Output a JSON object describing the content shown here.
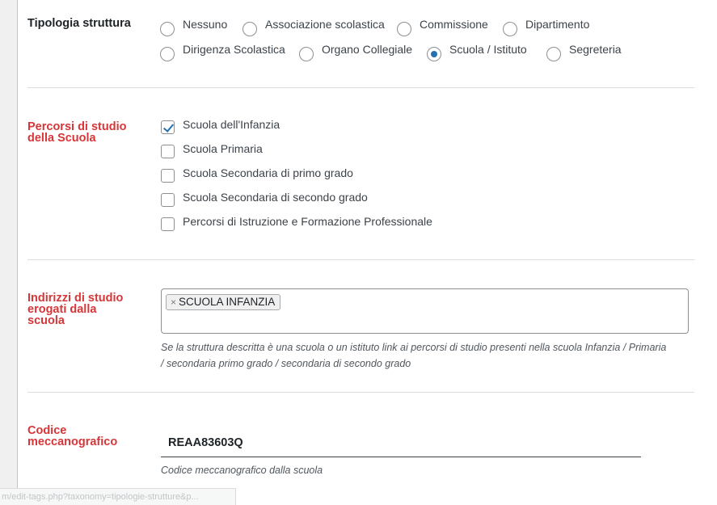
{
  "tipologia": {
    "label": "Tipologia struttura",
    "options": [
      "Nessuno",
      "Associazione scolastica",
      "Commissione",
      "Dipartimento",
      "Dirigenza Scolastica",
      "Organo Collegiale",
      "Scuola / Istituto",
      "Segreteria"
    ],
    "selected": "Scuola / Istituto"
  },
  "percorsi": {
    "label_line1": "Percorsi di studio",
    "label_line2": "della Scuola",
    "options": [
      "Scuola dell'Infanzia",
      "Scuola Primaria",
      "Scuola Secondaria di primo grado",
      "Scuola Secondaria di secondo grado",
      "Percorsi di Istruzione e Formazione Professionale"
    ],
    "checked": [
      "Scuola dell'Infanzia"
    ]
  },
  "indirizzi": {
    "label_line1": "Indirizzi di studio",
    "label_line2": "erogati dalla",
    "label_line3": "scuola",
    "tag_remove": "×",
    "tag": "SCUOLA INFANZIA",
    "description_line1": "Se la struttura descritta è una scuola o un istituto link ai percorsi di studio presenti nella scuola Infanzia / Primaria",
    "description_line2": "/ secondaria primo grado / secondaria di secondo grado"
  },
  "codice": {
    "label_line1": "Codice",
    "label_line2": "meccanografico",
    "value": "REAA83603Q",
    "description": "Codice meccanografico dalla scuola"
  },
  "status_bar": {
    "url": "m/edit-tags.php?taxonomy=tipologie-strutture&p..."
  },
  "colors": {
    "accent": "#2271b1",
    "required_label": "#d63638",
    "border": "#8c8f94"
  }
}
